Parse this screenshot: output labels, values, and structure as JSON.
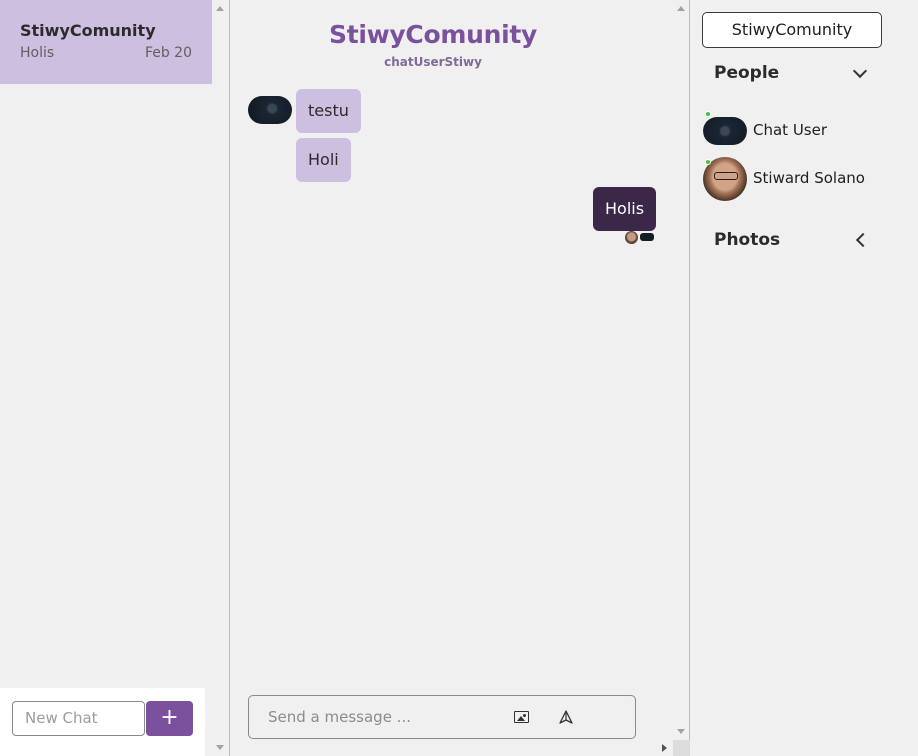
{
  "sidebar": {
    "chats": [
      {
        "title": "StiwyComunity",
        "last_message": "Holis",
        "date": "Feb 20"
      }
    ],
    "new_chat_placeholder": "New Chat",
    "new_chat_button": "+"
  },
  "chat": {
    "title": "StiwyComunity",
    "subtitle": "chatUserStiwy",
    "messages": [
      {
        "text": "testu",
        "direction": "incoming"
      },
      {
        "text": "Holi",
        "direction": "incoming"
      },
      {
        "text": "Holis",
        "direction": "outgoing"
      }
    ],
    "composer": {
      "placeholder": "Send a message ...",
      "image_icon": "image-icon",
      "send_icon": "send-icon"
    }
  },
  "settings": {
    "chat_title": "StiwyComunity",
    "people_heading": "People",
    "people": [
      {
        "name": "Chat User",
        "online": true
      },
      {
        "name": "Stiward Solano",
        "online": true
      }
    ],
    "photos_heading": "Photos"
  },
  "colors": {
    "accent": "#7b519e",
    "bubble_incoming": "#cdbfdf",
    "bubble_outgoing": "#3b2849",
    "active_chat": "#cdbfdf"
  }
}
